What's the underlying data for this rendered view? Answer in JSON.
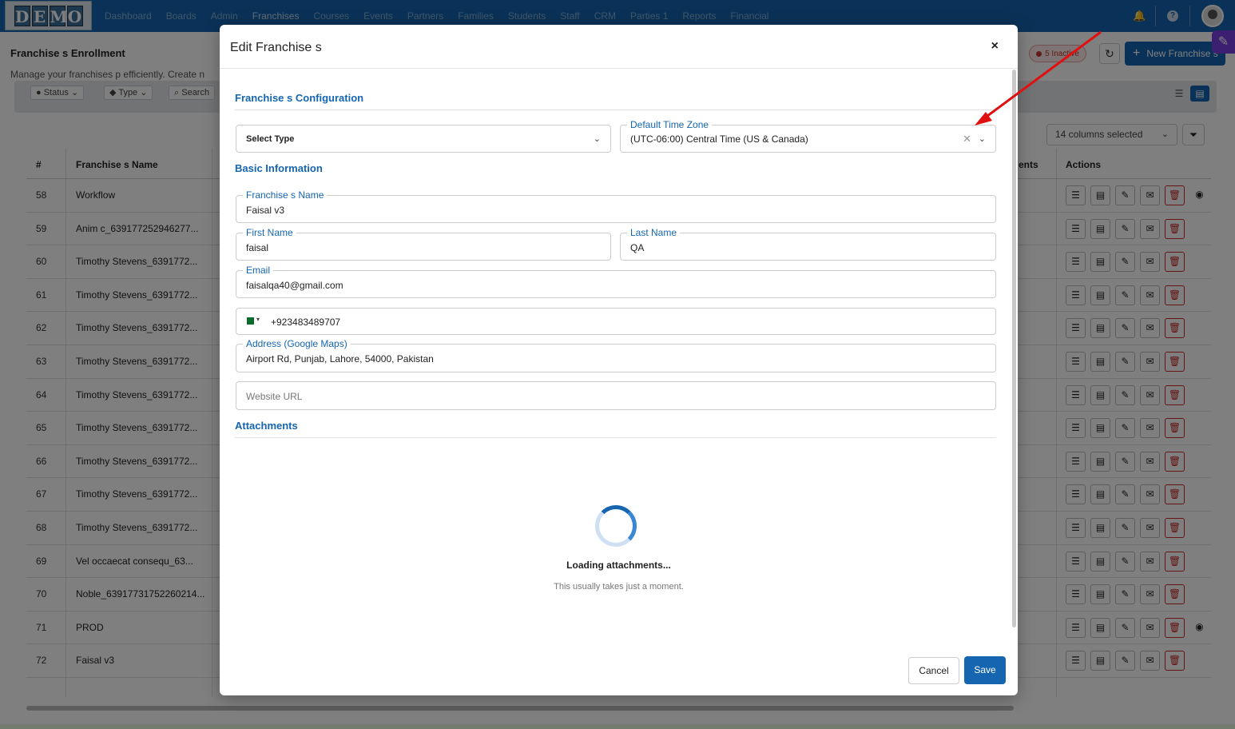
{
  "nav": {
    "logo_letters": [
      "D",
      "E",
      "M",
      "O"
    ],
    "links": [
      "Dashboard",
      "Boards",
      "Admin",
      "Franchises",
      "Courses",
      "Events",
      "Partners",
      "Families",
      "Students",
      "Staff",
      "CRM",
      "Parties 1",
      "Reports",
      "Financial"
    ],
    "active": "Franchises",
    "icons": [
      "bell-icon",
      "help-icon",
      "user-avatar"
    ]
  },
  "page": {
    "title": "Franchise s Enrollment",
    "subtitle": "Manage your franchises p efficiently. Create n",
    "inactive_badge": "5 Inactive",
    "new_button": "New Franchise s",
    "filters": {
      "status": "Status",
      "type": "Type",
      "search": "Search"
    },
    "columns_select": "14 columns selected",
    "table": {
      "headers": {
        "num": "#",
        "name": "Franchise s Name",
        "students": "ents",
        "actions": "Actions"
      },
      "rows": [
        {
          "num": "58",
          "name": "Workflow"
        },
        {
          "num": "59",
          "name": "Anim c_639177252946277..."
        },
        {
          "num": "60",
          "name": "Timothy Stevens_6391772..."
        },
        {
          "num": "61",
          "name": "Timothy Stevens_6391772..."
        },
        {
          "num": "62",
          "name": "Timothy Stevens_6391772..."
        },
        {
          "num": "63",
          "name": "Timothy Stevens_6391772..."
        },
        {
          "num": "64",
          "name": "Timothy Stevens_6391772..."
        },
        {
          "num": "65",
          "name": "Timothy Stevens_6391772..."
        },
        {
          "num": "66",
          "name": "Timothy Stevens_6391772..."
        },
        {
          "num": "67",
          "name": "Timothy Stevens_6391772..."
        },
        {
          "num": "68",
          "name": "Timothy Stevens_6391772..."
        },
        {
          "num": "69",
          "name": "Vel occaecat consequ_63..."
        },
        {
          "num": "70",
          "name": "Noble_63917731752260214..."
        },
        {
          "num": "71",
          "name": "PROD"
        },
        {
          "num": "72",
          "name": "Faisal v3"
        }
      ]
    }
  },
  "modal": {
    "title": "Edit Franchise s",
    "close_label": "×",
    "section_config": "Franchise s Configuration",
    "select_type": "Select Type",
    "timezone_label": "Default Time Zone",
    "timezone_value": "(UTC-06:00) Central Time (US & Canada)",
    "section_basic": "Basic Information",
    "name_label": "Franchise s Name",
    "name_value": "Faisal v3",
    "first_name_label": "First Name",
    "first_name_value": "faisal",
    "last_name_label": "Last Name",
    "last_name_value": "QA",
    "email_label": "Email",
    "email_value": "faisalqa40@gmail.com",
    "phone_value": "+923483489707",
    "address_label": "Address (Google Maps)",
    "address_value": "Airport Rd, Punjab, Lahore, 54000, Pakistan",
    "website_placeholder": "Website URL",
    "section_attachments": "Attachments",
    "loading_title": "Loading attachments...",
    "loading_sub": "This usually takes just a moment.",
    "cancel": "Cancel",
    "save": "Save"
  },
  "colors": {
    "primary": "#1565b0",
    "danger": "#c62828",
    "annotation_arrow": "#e01010"
  }
}
